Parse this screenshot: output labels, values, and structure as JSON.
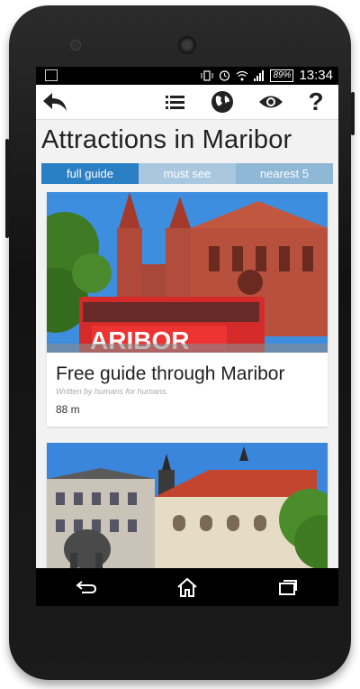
{
  "status": {
    "battery": "89%",
    "time": "13:34"
  },
  "toolbar": {
    "icons": [
      "back-arrow-icon",
      "list-icon",
      "globe-icon",
      "eye-icon",
      "help-icon"
    ],
    "help_label": "?"
  },
  "page": {
    "title": "Attractions in Maribor"
  },
  "tabs": [
    {
      "label": "full guide",
      "active": true
    },
    {
      "label": "must see",
      "active": false
    },
    {
      "label": "nearest 5",
      "active": false
    }
  ],
  "cards": [
    {
      "title": "Free guide through Maribor",
      "subtitle": "Written by humans for humans.",
      "distance": "88 m",
      "image_text": "ARIBOR"
    }
  ],
  "colors": {
    "tab_active": "#2b7fc3",
    "tab_inactive": "#a9c7de",
    "bus": "#d42a2a"
  }
}
